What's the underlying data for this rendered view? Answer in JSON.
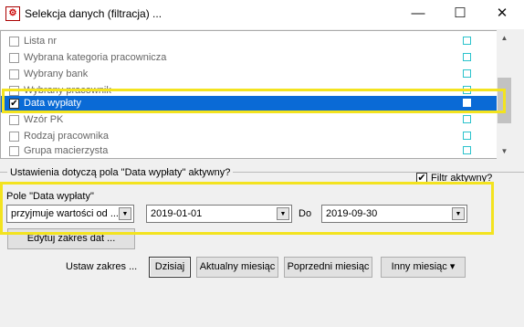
{
  "window": {
    "title": "Selekcja danych (filtracja) ...",
    "minimize": "—",
    "maximize": "☐",
    "close": "✕"
  },
  "list": {
    "items": [
      {
        "label": "Lista nr",
        "checked": false,
        "selected": false
      },
      {
        "label": "Wybrana kategoria pracownicza",
        "checked": false,
        "selected": false
      },
      {
        "label": "Wybrany bank",
        "checked": false,
        "selected": false
      },
      {
        "label": "Wybrany pracownik",
        "checked": false,
        "selected": false
      },
      {
        "label": "Data wypłaty",
        "checked": true,
        "selected": true
      },
      {
        "label": "Wzór PK",
        "checked": false,
        "selected": false
      },
      {
        "label": "Rodzaj pracownika",
        "checked": false,
        "selected": false
      },
      {
        "label": "Grupa macierzysta",
        "checked": false,
        "selected": false
      }
    ]
  },
  "settings": {
    "heading": "Ustawienia dotyczą pola \"Data wypłaty\" aktywny?",
    "active_filter_label": "Filtr aktywny?",
    "active_filter_checked": true,
    "field_label": "Pole \"Data wypłaty\"",
    "mode_value": "przyjmuje wartości od ...",
    "date_from": "2019-01-01",
    "to_label": "Do",
    "date_to": "2019-09-30",
    "edit_range_button": "Edytuj zakres dat ...",
    "set_range_label": "Ustaw zakres ...",
    "today_button": "Dzisiaj",
    "current_month_button": "Aktualny miesiąc",
    "previous_month_button": "Poprzedni miesiąc",
    "other_month_button": "Inny miesiąc ▾"
  },
  "colors": {
    "selection": "#0a6ad6",
    "highlight": "#f3e31f",
    "marker": "#2bc3cc"
  }
}
